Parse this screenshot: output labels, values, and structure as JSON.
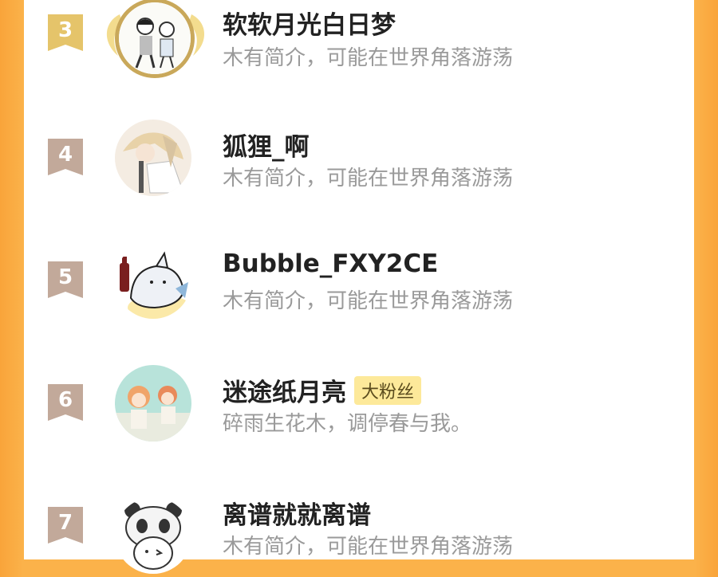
{
  "rows": [
    {
      "rank": "3",
      "name": "软软月光白日梦",
      "bio": "木有简介，可能在世界角落游荡",
      "badge": "",
      "ribbon_color": "#e5c46a",
      "avatar": "boy-girl-drawing-icon"
    },
    {
      "rank": "4",
      "name": "狐狸_啊",
      "bio": "木有简介，可能在世界角落游荡",
      "badge": "",
      "ribbon_color": "#c2a99a",
      "avatar": "anime-character-icon"
    },
    {
      "rank": "5",
      "name": "Bubble_FXY2CE",
      "bio": "木有简介，可能在世界角落游荡",
      "badge": "",
      "ribbon_color": "#c2a99a",
      "avatar": "shark-cola-icon"
    },
    {
      "rank": "6",
      "name": "迷途纸月亮",
      "bio": "碎雨生花木，调停春与我。",
      "badge": "大粉丝",
      "ribbon_color": "#c2a99a",
      "avatar": "two-kids-illustration-icon"
    },
    {
      "rank": "7",
      "name": "离谱就就离谱",
      "bio": "木有简介，可能在世界角落游荡",
      "badge": "",
      "ribbon_color": "#c2a99a",
      "avatar": "panda-hat-boy-icon"
    }
  ],
  "colors": {
    "background": "#fbb24a",
    "panel": "#ffffff",
    "gold_frame": "#c9a85a",
    "badge_bg": "#fde99a"
  }
}
